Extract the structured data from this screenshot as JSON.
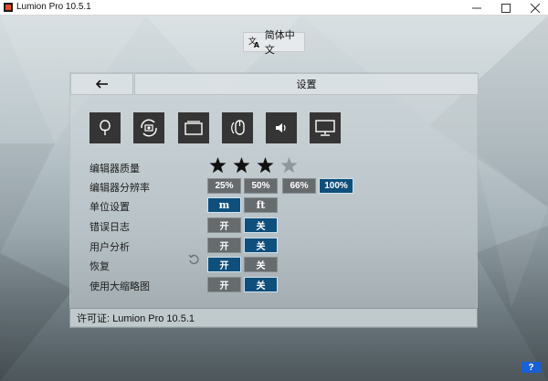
{
  "window": {
    "title": "Lumion Pro 10.5.1",
    "minimize_icon": "minimize-icon",
    "maximize_icon": "maximize-icon",
    "close_icon": "close-icon"
  },
  "language": {
    "label": "简体中文",
    "icon": "translate-icon"
  },
  "header": {
    "title": "设置",
    "back_icon": "arrow-left-icon"
  },
  "categories": [
    {
      "name": "editor-quality",
      "icon": "tree-icon"
    },
    {
      "name": "camera",
      "icon": "camera-rotate-icon"
    },
    {
      "name": "display",
      "icon": "window-icon"
    },
    {
      "name": "mouse",
      "icon": "mouse-icon"
    },
    {
      "name": "sound",
      "icon": "speaker-icon"
    },
    {
      "name": "monitor",
      "icon": "monitor-icon"
    }
  ],
  "settings": {
    "editor_quality": {
      "label": "编辑器质量",
      "rating": 3,
      "max": 4
    },
    "editor_resolution": {
      "label": "编辑器分辨率",
      "options": [
        "25%",
        "50%",
        "66%",
        "100%"
      ],
      "selected": "100%"
    },
    "units": {
      "label": "单位设置",
      "options": [
        "m",
        "ft"
      ],
      "selected": "m"
    },
    "error_log": {
      "label": "错误日志",
      "on_label": "开",
      "off_label": "关",
      "selected": "关"
    },
    "user_analytics": {
      "label": "用户分析",
      "on_label": "开",
      "off_label": "关",
      "selected": "关",
      "reset_icon": "reset-icon"
    },
    "restore": {
      "label": "恢复",
      "on_label": "开",
      "off_label": "关",
      "selected": "开"
    },
    "large_thumbnails": {
      "label": "使用大缩略图",
      "on_label": "开",
      "off_label": "关",
      "selected": "关"
    }
  },
  "license": {
    "text": "许可证: Lumion Pro 10.5.1"
  },
  "help": {
    "label": "?"
  },
  "colors": {
    "accent": "#0f4f7c",
    "option_off": "#666b6e",
    "category_bg": "#353535",
    "help": "#1860d6"
  }
}
